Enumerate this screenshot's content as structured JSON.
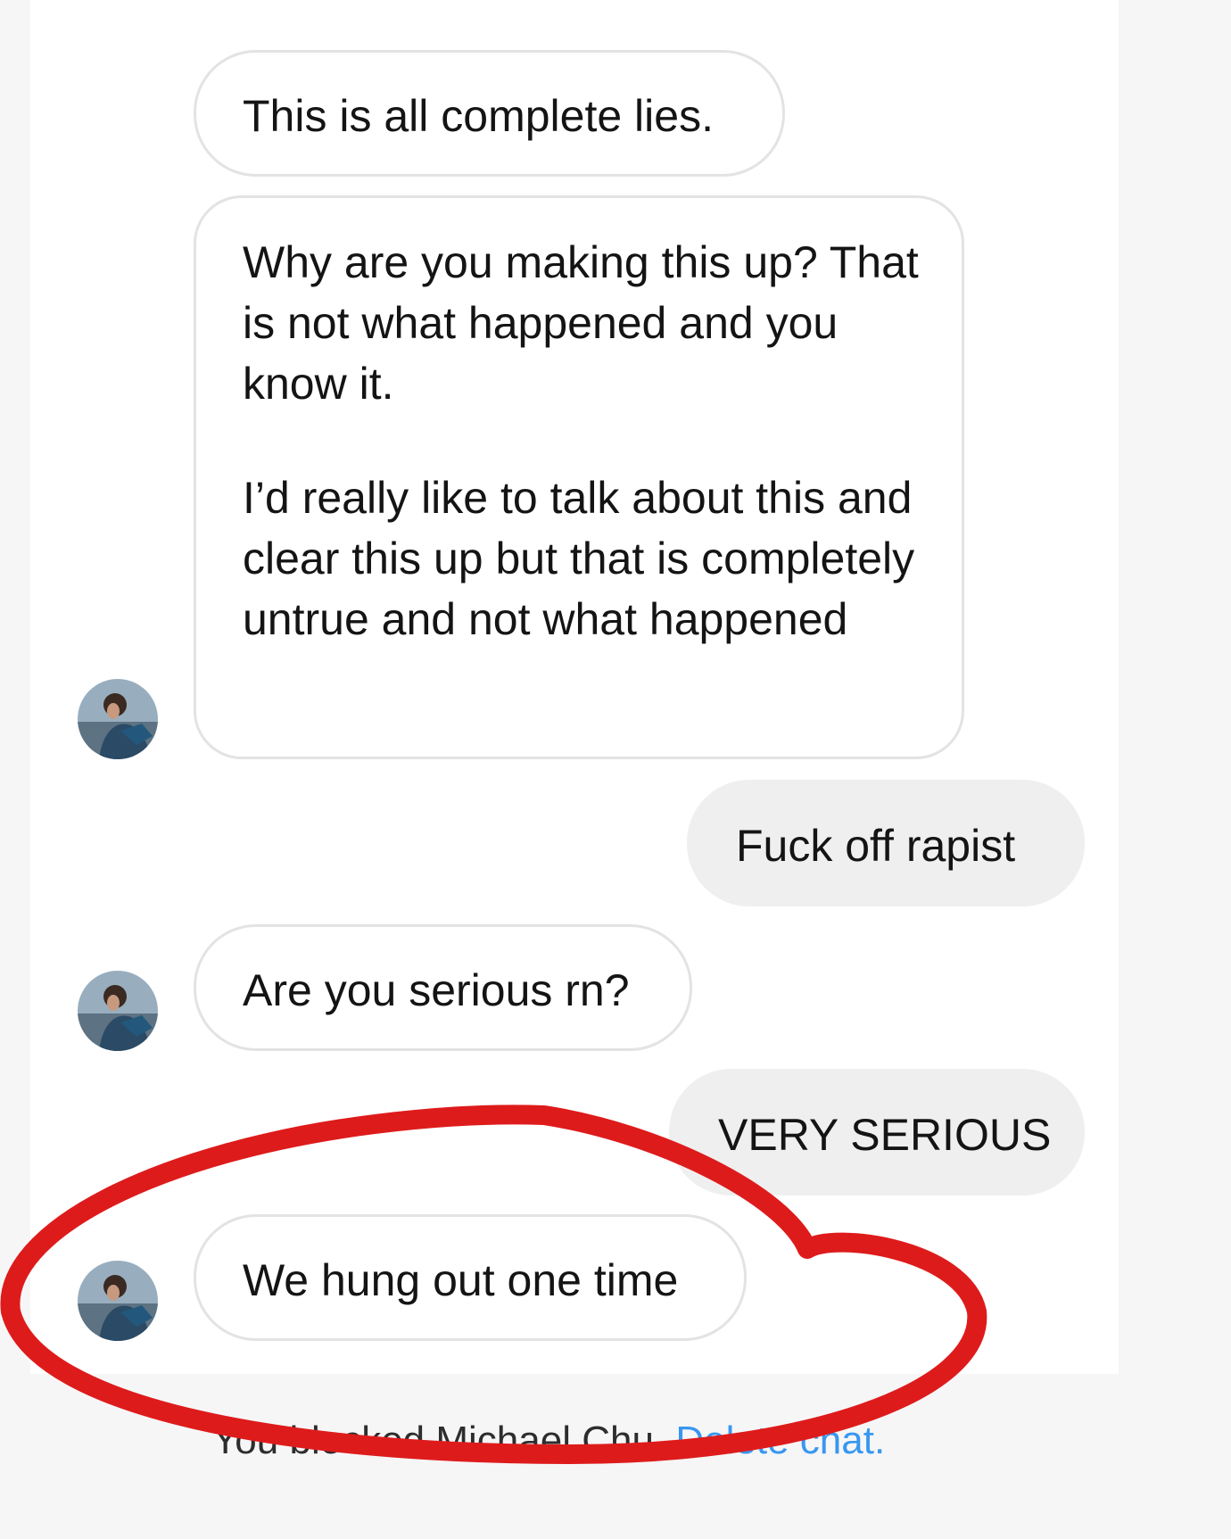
{
  "messages": [
    {
      "direction": "received",
      "paragraphs": [
        "This is all complete lies."
      ]
    },
    {
      "direction": "received",
      "paragraphs": [
        "Why are you making this up? That is not what happened and you know it.",
        "I’d really like to talk about this and clear this up but that is completely untrue and not what happened"
      ]
    },
    {
      "direction": "sent",
      "paragraphs": [
        "Fuck off rapist"
      ]
    },
    {
      "direction": "received",
      "paragraphs": [
        "Are you serious rn?"
      ]
    },
    {
      "direction": "sent",
      "paragraphs": [
        "VERY SERIOUS"
      ]
    },
    {
      "direction": "received",
      "paragraphs": [
        "We hung out one time"
      ]
    }
  ],
  "footer": {
    "status_text": "You blocked Michael Chu.",
    "action_link": "Delete chat."
  },
  "icons": {
    "avatar": "profile-photo"
  },
  "colors": {
    "annotation_stroke": "#de1b1b",
    "link": "#3897f0",
    "sent_bubble": "#efeff0",
    "received_border": "#e3e3e5"
  }
}
